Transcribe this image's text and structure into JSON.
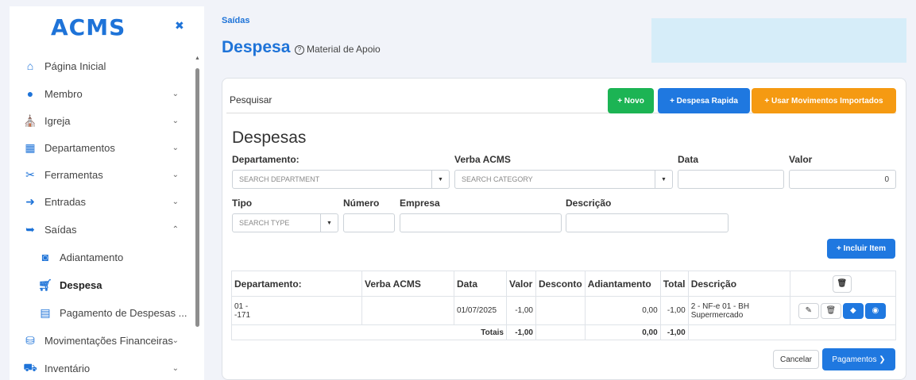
{
  "app": {
    "logo": "ACMS",
    "pin_icon": "pin-icon"
  },
  "sidebar": {
    "items": [
      {
        "label": "Página Inicial",
        "icon": "home-icon"
      },
      {
        "label": "Membro",
        "icon": "user-icon"
      },
      {
        "label": "Igreja",
        "icon": "church-icon"
      },
      {
        "label": "Departamentos",
        "icon": "sitemap-icon"
      },
      {
        "label": "Ferramentas",
        "icon": "tools-icon"
      },
      {
        "label": "Entradas",
        "icon": "sign-in-icon"
      },
      {
        "label": "Saídas",
        "icon": "sign-out-icon"
      },
      {
        "label": "Adiantamento",
        "icon": "advance-icon"
      },
      {
        "label": "Despesa",
        "icon": "cart-icon"
      },
      {
        "label": "Pagamento de Despesas ...",
        "icon": "bill-icon"
      },
      {
        "label": "Movimentações Financeiras",
        "icon": "coins-icon"
      },
      {
        "label": "Inventário",
        "icon": "inventory-icon"
      }
    ]
  },
  "header": {
    "breadcrumb": "Saídas",
    "title": "Despesa",
    "help": "Material de Apoio"
  },
  "toolbar": {
    "tab": "Pesquisar",
    "novo": "+ Novo",
    "despesa_rapida": "+ Despesa Rapida",
    "usar_mov": "+ Usar Movimentos Importados"
  },
  "form": {
    "heading": "Despesas",
    "departamento_label": "Departamento:",
    "departamento_placeholder": "SEARCH DEPARTMENT",
    "verba_label": "Verba ACMS",
    "verba_placeholder": "SEARCH CATEGORY",
    "data_label": "Data",
    "valor_label": "Valor",
    "valor_value": "0",
    "tipo_label": "Tipo",
    "tipo_placeholder": "SEARCH TYPE",
    "numero_label": "Número",
    "empresa_label": "Empresa",
    "descricao_label": "Descrição",
    "incluir": "+ Incluir Item"
  },
  "table": {
    "headers": [
      "Departamento:",
      "Verba ACMS",
      "Data",
      "Valor",
      "Desconto",
      "Adiantamento",
      "Total",
      "Descrição"
    ],
    "row": {
      "departamento_1": "01 -",
      "departamento_2": "-171",
      "verba": "",
      "data": "01/07/2025",
      "valor": "-1,00",
      "desconto": "",
      "adiantamento": "0,00",
      "total": "-1,00",
      "descricao_1": "2 - NF-e 01 - BH",
      "descricao_2": "Supermercado"
    },
    "totals": {
      "label": "Totais",
      "valor": "-1,00",
      "adiantamento": "0,00",
      "total": "-1,00"
    }
  },
  "footer": {
    "cancel": "Cancelar",
    "pagamentos": "Pagamentos ❯"
  }
}
